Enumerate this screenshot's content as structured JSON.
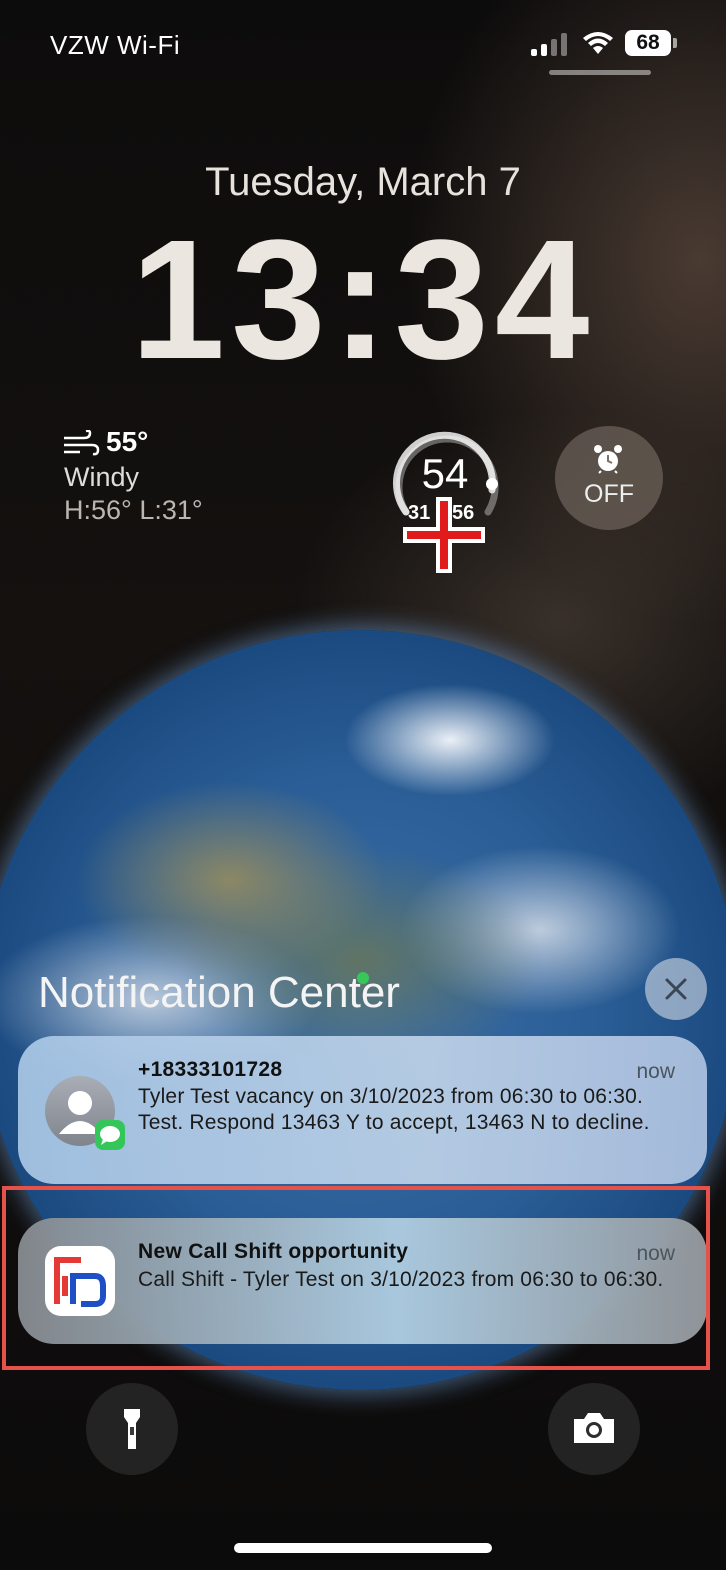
{
  "status_bar": {
    "carrier": "VZW Wi-Fi",
    "battery": "68",
    "icons": [
      "cellular-signal-icon",
      "wifi-icon",
      "battery-icon"
    ]
  },
  "lock_screen": {
    "date": "Tuesday, March 7",
    "time": "13:34"
  },
  "weather_widget": {
    "temperature": "55°",
    "condition": "Windy",
    "high_low": "H:56° L:31°",
    "icon": "wind-icon"
  },
  "temperature_gauge": {
    "current": "54",
    "low": "31",
    "high": "56"
  },
  "alarm_widget": {
    "icon": "alarm-clock-icon",
    "label": "OFF"
  },
  "notification_center": {
    "title": "Notification Center",
    "notifications": [
      {
        "title": "+18333101728",
        "time": "now",
        "body": "Tyler Test vacancy on 3/10/2023 from 06:30 to 06:30. Test. Respond 13463 Y to accept, 13463 N to decline.",
        "icon": "contact-avatar-icon"
      },
      {
        "title": "New Call Shift opportunity",
        "time": "now",
        "body": "Call Shift - Tyler Test on 3/10/2023 from 06:30 to 06:30.",
        "icon": "call-shift-app-icon"
      }
    ]
  },
  "bottom_controls": {
    "left": "flashlight-icon",
    "right": "camera-icon"
  },
  "colors": {
    "highlight": "#e6524a",
    "crosshair": "#e11b1b"
  }
}
